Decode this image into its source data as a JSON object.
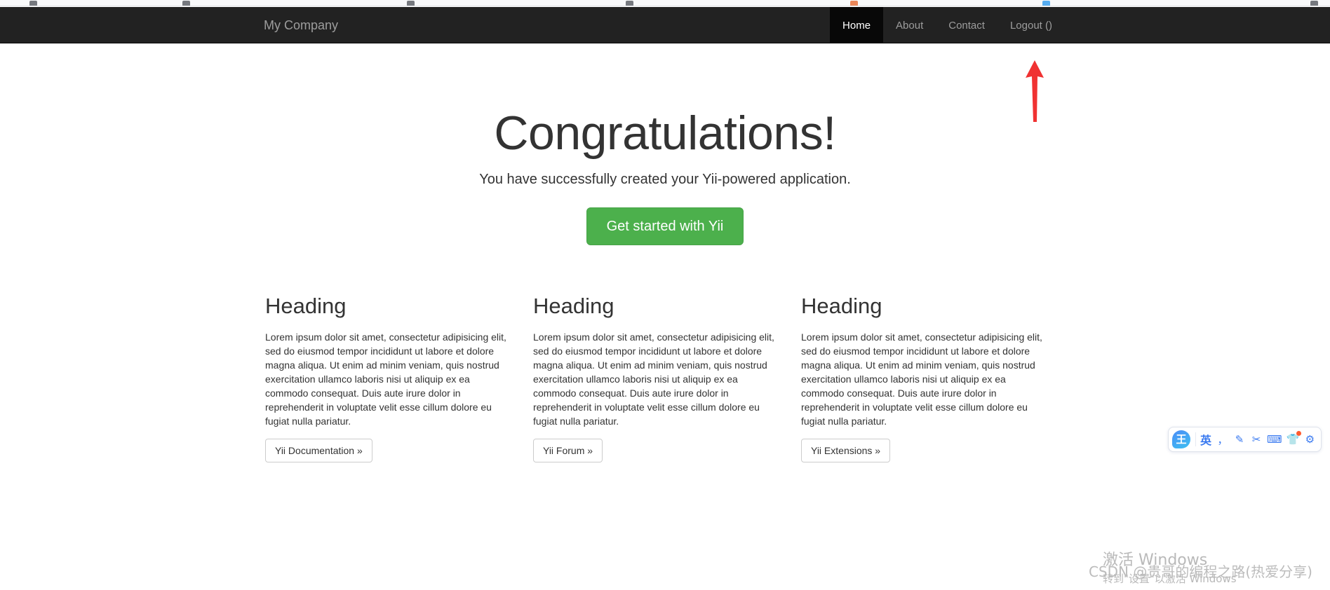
{
  "browser": {
    "bookmark_marks": 8
  },
  "navbar": {
    "brand": "My Company",
    "items": [
      {
        "label": "Home",
        "active": true
      },
      {
        "label": "About",
        "active": false
      },
      {
        "label": "Contact",
        "active": false
      },
      {
        "label": "Logout ()",
        "active": false
      }
    ],
    "bg_color": "#222222",
    "active_bg_color": "#080808",
    "link_color": "#9d9d9d"
  },
  "hero": {
    "title": "Congratulations!",
    "lead": "You have successfully created your Yii-powered application.",
    "cta_label": "Get started with Yii",
    "cta_color": "#4cb04c"
  },
  "columns": [
    {
      "heading": "Heading",
      "body": "Lorem ipsum dolor sit amet, consectetur adipisicing elit, sed do eiusmod tempor incididunt ut labore et dolore magna aliqua. Ut enim ad minim veniam, quis nostrud exercitation ullamco laboris nisi ut aliquip ex ea commodo consequat. Duis aute irure dolor in reprehenderit in voluptate velit esse cillum dolore eu fugiat nulla pariatur.",
      "button_label": "Yii Documentation »"
    },
    {
      "heading": "Heading",
      "body": "Lorem ipsum dolor sit amet, consectetur adipisicing elit, sed do eiusmod tempor incididunt ut labore et dolore magna aliqua. Ut enim ad minim veniam, quis nostrud exercitation ullamco laboris nisi ut aliquip ex ea commodo consequat. Duis aute irure dolor in reprehenderit in voluptate velit esse cillum dolore eu fugiat nulla pariatur.",
      "button_label": "Yii Forum »"
    },
    {
      "heading": "Heading",
      "body": "Lorem ipsum dolor sit amet, consectetur adipisicing elit, sed do eiusmod tempor incididunt ut labore et dolore magna aliqua. Ut enim ad minim veniam, quis nostrud exercitation ullamco laboris nisi ut aliquip ex ea commodo consequat. Duis aute irure dolor in reprehenderit in voluptate velit esse cillum dolore eu fugiat nulla pariatur.",
      "button_label": "Yii Extensions »"
    }
  ],
  "annotation": {
    "arrow_color": "#f03232",
    "arrow_direction": "up"
  },
  "ime_toolbar": {
    "logo_glyph": "王",
    "language_mode": "英",
    "accent_color": "#3a7af0",
    "items": [
      {
        "icon": "comma-punctuation-icon",
        "glyph": "，"
      },
      {
        "icon": "pen-handwriting-icon",
        "glyph": "✎"
      },
      {
        "icon": "scissors-screenshot-icon",
        "glyph": "✂"
      },
      {
        "icon": "keyboard-soft-icon",
        "glyph": "⌨"
      },
      {
        "icon": "skin-theme-icon",
        "glyph": "👕",
        "badge": true
      },
      {
        "icon": "gear-settings-icon",
        "glyph": "⚙"
      }
    ]
  },
  "watermarks": {
    "windows_line1": "激活 Windows",
    "windows_line2": "转到\"设置\"以激活 Windows",
    "csdn": "CSDN @贵哥的编程之路(热爱分享)"
  }
}
